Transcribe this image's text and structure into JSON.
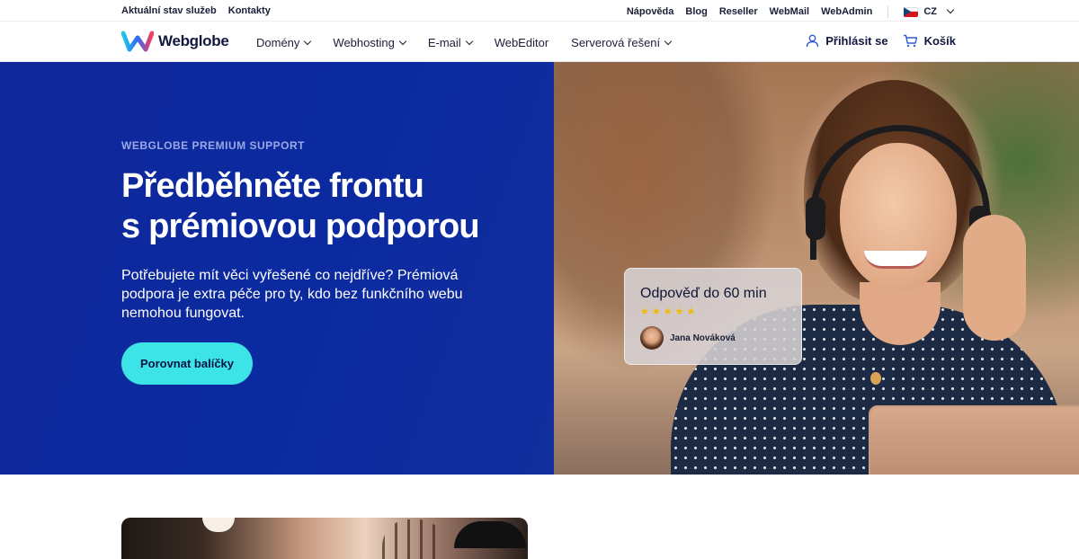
{
  "utility_bar": {
    "left_links": [
      "Aktuální stav služeb",
      "Kontakty"
    ],
    "right_links": [
      "Nápověda",
      "Blog",
      "Reseller",
      "WebMail",
      "WebAdmin"
    ],
    "language": "CZ"
  },
  "nav": {
    "logo_text": "Webglobe",
    "menu": [
      "Domény",
      "Webhosting",
      "E-mail",
      "WebEditor",
      "Serverová řešení"
    ],
    "login_label": "Přihlásit se",
    "cart_label": "Košík"
  },
  "hero": {
    "eyebrow": "WEBGLOBE PREMIUM SUPPORT",
    "headline_line1": "Předběhněte frontu",
    "headline_line2": "s prémiovou podporou",
    "lead": "Potřebujete mít věci vyřešené co nejdříve? Prémiová podpora je extra péče pro ty, kdo bez funkčního webu nemohou fungovat.",
    "cta_label": "Porovnat balíčky"
  },
  "review_card": {
    "title": "Odpověď do 60 min",
    "rating": 5,
    "reviewer_name": "Jana Nováková"
  },
  "colors": {
    "hero_blue": "#0b2aa0",
    "cta_cyan": "#3ce3e7",
    "star": "#f5b800"
  }
}
